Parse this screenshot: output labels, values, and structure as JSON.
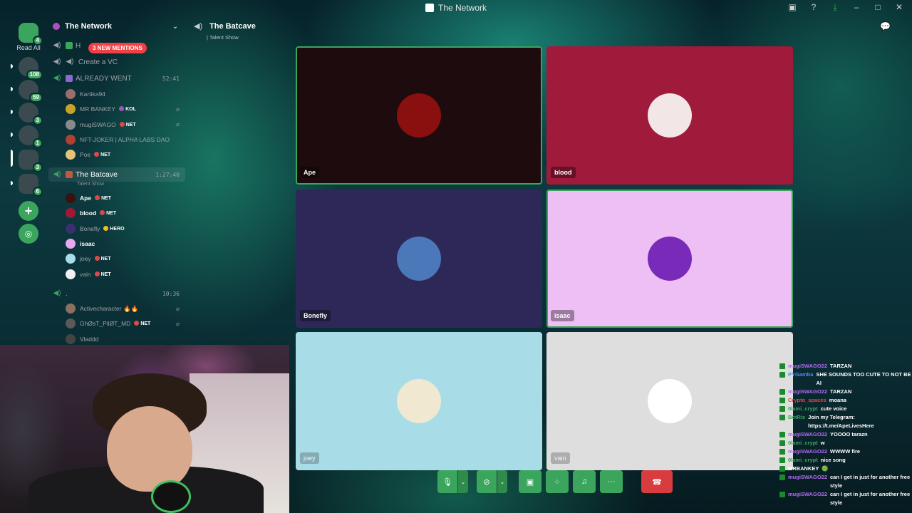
{
  "app": {
    "title": "The Network"
  },
  "rail": {
    "read_all": "Read All",
    "servers": [
      {
        "badge": "4",
        "color": "#3ba55d"
      },
      {
        "badge": "108",
        "color": "#2e7d6b"
      },
      {
        "badge": "59",
        "color": "#7a6a5a"
      },
      {
        "badge": "3",
        "color": "#d64a9a"
      },
      {
        "badge": "1",
        "color": "#2a2a2a"
      },
      {
        "badge": "3",
        "color": "#333333"
      },
      {
        "badge": "6",
        "color": "#4a6a8a"
      }
    ]
  },
  "sidebar": {
    "server_name": "The Network",
    "mentions": "3 NEW MENTIONS",
    "channels": [
      {
        "name": "H",
        "time": ""
      },
      {
        "name": "Create a VC",
        "time": ""
      },
      {
        "name": "ALREADY WENT",
        "time": "52:41"
      },
      {
        "name": "The Batcave",
        "time": "1:27:40",
        "sub": "Talent Show"
      },
      {
        "name": ".",
        "time": "10:36"
      }
    ],
    "already_went_members": [
      {
        "name": "Kartika94",
        "tag": "",
        "tagcolor": "",
        "av": "#9b6d6d"
      },
      {
        "name": "MR BANKEY",
        "tag": "KOL",
        "tagcolor": "#9b59b6",
        "av": "#c9a227"
      },
      {
        "name": "mugiSWAGO",
        "tag": "NET",
        "tagcolor": "#e04848",
        "av": "#8a8a8a"
      },
      {
        "name": "NFT-JOKER | ALPHA LABS DAO",
        "tag": "",
        "tagcolor": "",
        "av": "#b04030"
      },
      {
        "name": "Poe",
        "tag": "NET",
        "tagcolor": "#e04848",
        "av": "#e8c27a"
      }
    ],
    "batcave_members": [
      {
        "name": "Ape",
        "tag": "NET",
        "tagcolor": "#e04848",
        "av": "#3a1010",
        "bright": true
      },
      {
        "name": "blood",
        "tag": "NET",
        "tagcolor": "#e04848",
        "av": "#a01838",
        "bright": true
      },
      {
        "name": "Bonefly",
        "tag": "HERO",
        "tagcolor": "#f0c020",
        "av": "#3a3070",
        "bright": false
      },
      {
        "name": "isaac",
        "tag": "",
        "tagcolor": "",
        "av": "#e8a8f0",
        "bright": true
      },
      {
        "name": "joey",
        "tag": "NET",
        "tagcolor": "#e04848",
        "av": "#a8dce8",
        "bright": false
      },
      {
        "name": "vain",
        "tag": "NET",
        "tagcolor": "#e04848",
        "av": "#f0f0f0",
        "bright": false
      }
    ],
    "dot_members": [
      {
        "name": "Activecharacter 🔥🔥",
        "tag": "",
        "tagcolor": "",
        "av": "#8a7060"
      },
      {
        "name": "GhØsT_PilØT_MD",
        "tag": "NET",
        "tagcolor": "#e04848",
        "av": "#5a5a5a"
      },
      {
        "name": "Vladdd",
        "tag": "",
        "tagcolor": "",
        "av": "#444444"
      }
    ]
  },
  "header": {
    "channel": "The Batcave",
    "topic": "| Talent Show"
  },
  "tiles": [
    {
      "name": "Ape",
      "bg": "#1e0b0d",
      "av": "#8a1010",
      "speaking": true
    },
    {
      "name": "blood",
      "bg": "#a01a3c",
      "av": "#f2e6e6",
      "speaking": false
    },
    {
      "name": "Bonefly",
      "bg": "#2e2858",
      "av": "#4a78b8",
      "speaking": false
    },
    {
      "name": "isaac",
      "bg": "#eebff4",
      "av": "#7a2ab8",
      "speaking": true
    },
    {
      "name": "joey",
      "bg": "#a8dde8",
      "av": "#f0e8d0",
      "speaking": false
    },
    {
      "name": "vain",
      "bg": "#dedede",
      "av": "#ffffff",
      "speaking": false
    }
  ],
  "chat": [
    {
      "user": "mugiSWAGO22",
      "color": "#b06af0",
      "text": "TARZAN"
    },
    {
      "user": "PYGamba",
      "color": "#4a8ef0",
      "text": "SHE SOUNDS TOO CUTE TO NOT BE AI"
    },
    {
      "user": "mugiSWAGO22",
      "color": "#b06af0",
      "text": "TARZAN"
    },
    {
      "user": "Crypto_spaces",
      "color": "#e04848",
      "text": "moana"
    },
    {
      "user": "0lami_crypt",
      "color": "#3ba55d",
      "text": "cute voice"
    },
    {
      "user": "BotRix",
      "color": "#3ba55d",
      "text": "Join my Telegram: https://t.me/ApeLivesHere"
    },
    {
      "user": "mugiSWAGO22",
      "color": "#b06af0",
      "text": "YOOOO tarazn"
    },
    {
      "user": "0lami_crypt",
      "color": "#3ba55d",
      "text": "w"
    },
    {
      "user": "mugiSWAGO22",
      "color": "#b06af0",
      "text": "WWWW fire"
    },
    {
      "user": "0lami_crypt",
      "color": "#3ba55d",
      "text": "nice song"
    },
    {
      "user": "MRBANKEY",
      "color": "#ffffff",
      "text": "🟢"
    },
    {
      "user": "mugiSWAGO22",
      "color": "#b06af0",
      "text": "can I get in just for another free style"
    },
    {
      "user": "mugiSWAGO22",
      "color": "#b06af0",
      "text": "can I get in just for another free style"
    }
  ]
}
